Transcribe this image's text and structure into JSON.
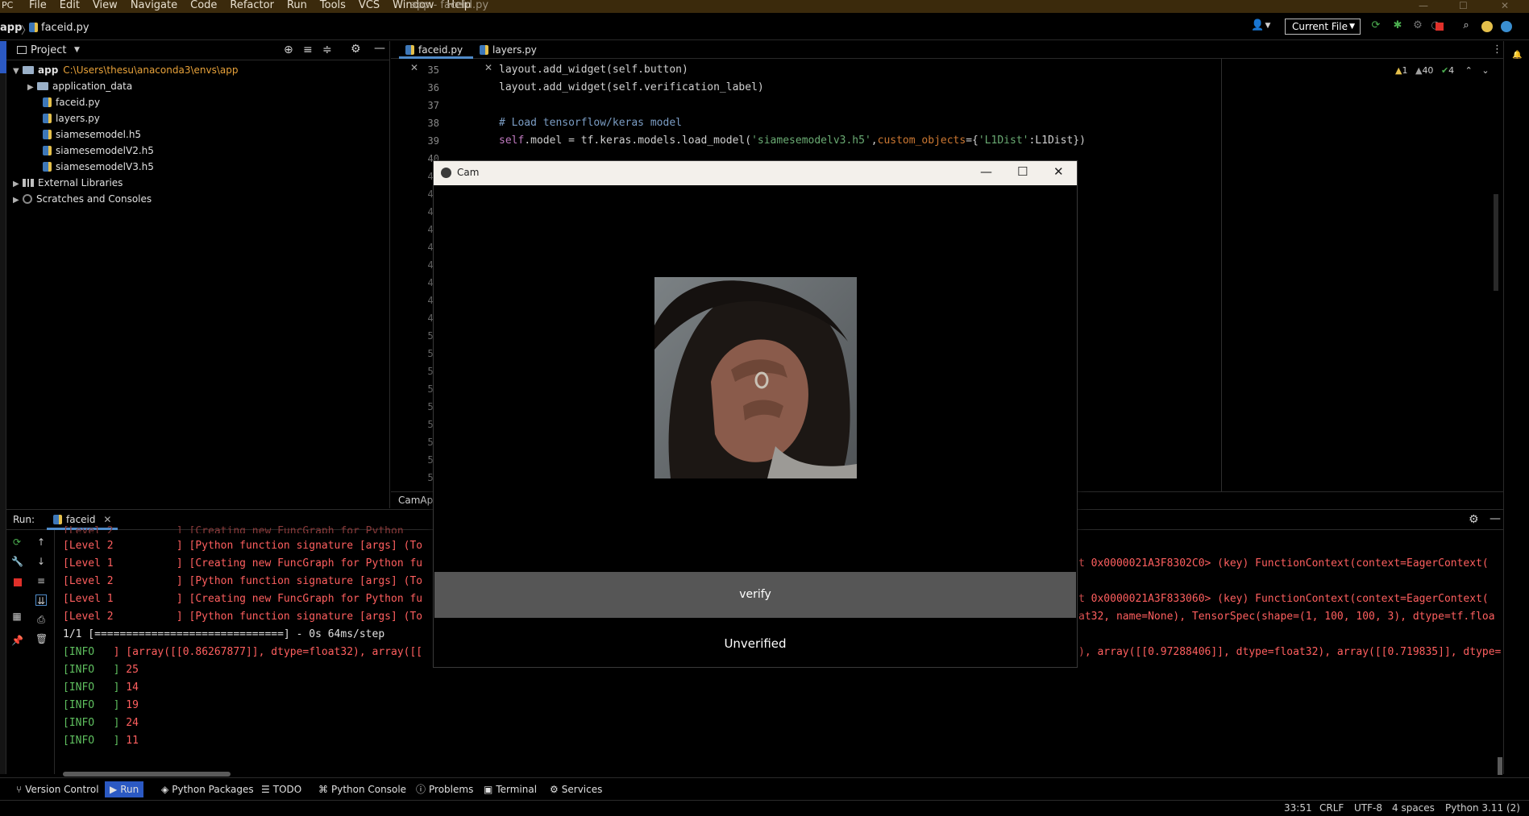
{
  "titlebar": {
    "menu": [
      "File",
      "Edit",
      "View",
      "Navigate",
      "Code",
      "Refactor",
      "Run",
      "Tools",
      "VCS",
      "Window",
      "Help"
    ],
    "window_title": "app - faceid.py"
  },
  "navbar": {
    "crumb_project": "app",
    "crumb_file": "faceid.py",
    "run_config": "Current File"
  },
  "project": {
    "title": "Project",
    "root_name": "app",
    "root_path": "C:\\Users\\thesu\\anaconda3\\envs\\app",
    "items": [
      "application_data",
      "faceid.py",
      "layers.py",
      "siamesemodel.h5",
      "siamesemodelV2.h5",
      "siamesemodelV3.h5"
    ],
    "external": "External Libraries",
    "scratches": "Scratches and Consoles"
  },
  "editor": {
    "tabs": [
      "faceid.py",
      "layers.py"
    ],
    "inspection": {
      "warn1": "1",
      "warn2": "40",
      "ok": "4"
    },
    "line_numbers": [
      "35",
      "36",
      "37",
      "38",
      "39",
      "40",
      "41",
      "42",
      "43",
      "44",
      "45",
      "46",
      "47",
      "48",
      "49",
      "50",
      "51",
      "52",
      "53",
      "54",
      "55",
      "56",
      "57",
      "58"
    ],
    "code": {
      "l35": "layout.add_widget(self.button)",
      "l36": "layout.add_widget(self.verification_label)",
      "l38": "# Load tensorflow/keras model",
      "l39_pre": "self",
      "l39_mid": ".model = tf.keras.models.load_model(",
      "l39_str": "'siamesemodelv3.h5'",
      "l39_param": "custom_objects",
      "l39_eq": "={",
      "l39_str2": "'L1Dist'",
      "l39_end": ":L1Dist})"
    },
    "breadcrumb": "CamApp"
  },
  "run": {
    "label": "Run:",
    "tab": "faceid",
    "lines": [
      {
        "type": "red",
        "text": "[Level 2          ] [Python function signature [args] (To"
      },
      {
        "type": "red",
        "text": "[Level 1          ] [Creating new FuncGraph for Python fu"
      },
      {
        "type": "red",
        "text": "[Level 2          ] [Python function signature [args] (To"
      },
      {
        "type": "red",
        "text": "[Level 1          ] [Creating new FuncGraph for Python fu"
      },
      {
        "type": "red",
        "text": "[Level 2          ] [Python function signature [args] (To"
      }
    ],
    "right_lines": [
      "t 0x0000021A3F8302C0> (key) FunctionContext(context=EagerContext(",
      "t 0x0000021A3F833060> (key) FunctionContext(context=EagerContext(",
      "at32, name=None), TensorSpec(shape=(1, 100, 100, 3), dtype=tf.floa"
    ],
    "progress": "1/1 [==============================] - 0s 64ms/step",
    "array_line": "] [array([[0.86267877]], dtype=float32), array([[",
    "array_right": "), array([[0.97288406]], dtype=float32), array([[0.719835]], dtype=",
    "info_values": [
      "25",
      "14",
      "19",
      "24",
      "11"
    ],
    "info_tag": "[INFO   ",
    "level_tag_top": "[Level 2          ] [Creating new FuncGraph for Python"
  },
  "cam": {
    "title": "Cam",
    "button": "verify",
    "status": "Unverified"
  },
  "toolwindows": [
    "Version Control",
    "Run",
    "Python Packages",
    "TODO",
    "Python Console",
    "Problems",
    "Terminal",
    "Services"
  ],
  "status": {
    "pos": "33:51",
    "eol": "CRLF",
    "enc": "UTF-8",
    "indent": "4 spaces",
    "interp": "Python 3.11 (2)"
  }
}
